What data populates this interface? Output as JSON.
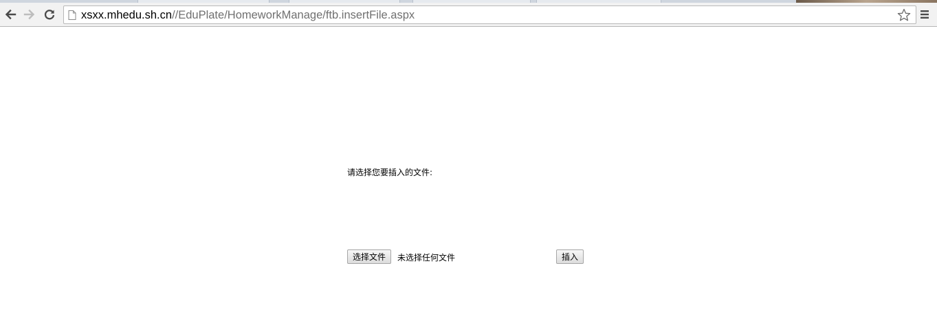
{
  "browser": {
    "address": {
      "host": "xsxx.mhedu.sh.cn",
      "path": "//EduPlate/HomeworkManage/ftb.insertFile.aspx"
    },
    "icons": {
      "back": "back-arrow-icon",
      "forward": "forward-arrow-icon",
      "reload": "reload-icon",
      "page": "page-icon",
      "bookmark": "star-icon",
      "menu": "hamburger-menu-icon"
    }
  },
  "page": {
    "prompt": "请选择您要插入的文件:",
    "choose_file_label": "选择文件",
    "no_file_text": "未选择任何文件",
    "insert_label": "插入"
  }
}
